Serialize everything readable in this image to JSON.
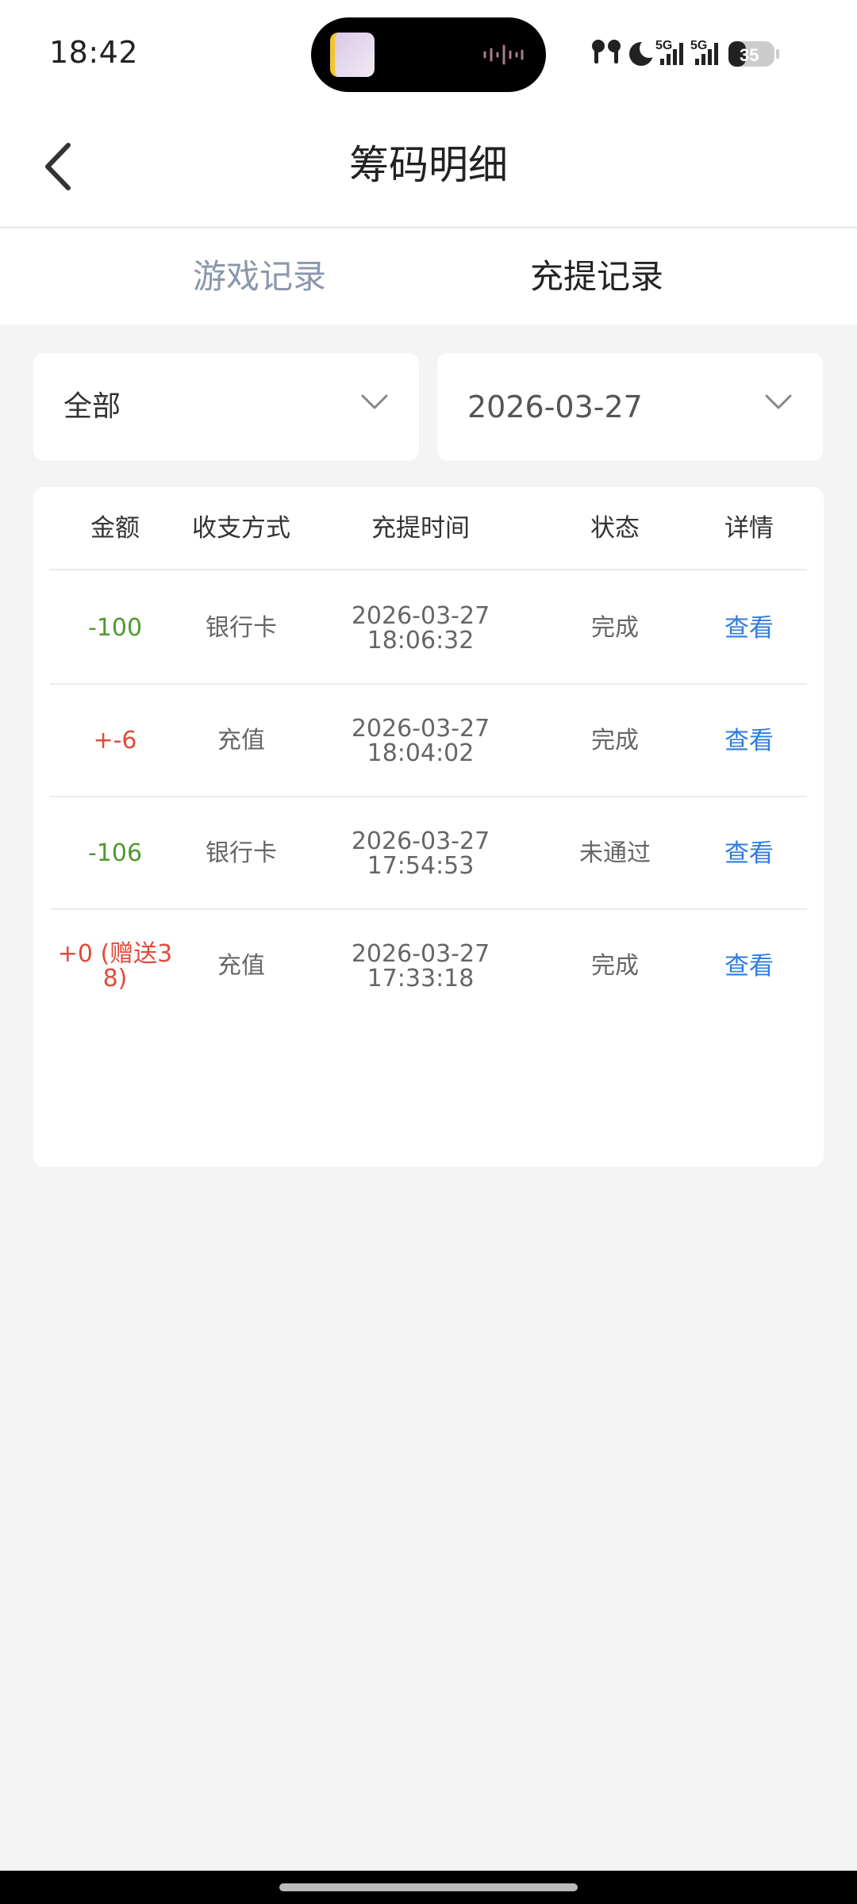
{
  "status_bar": {
    "time": "18:42",
    "signal_label_1": "5G",
    "signal_label_2": "5G",
    "battery": "35"
  },
  "header": {
    "title": "筹码明细"
  },
  "tabs": [
    {
      "label": "游戏记录",
      "active": false
    },
    {
      "label": "充提记录",
      "active": true
    }
  ],
  "filters": {
    "type": {
      "value": "全部"
    },
    "date": {
      "value": "2026-03-27"
    }
  },
  "table": {
    "columns": [
      "金额",
      "收支方式",
      "充提时间",
      "状态",
      "详情"
    ],
    "rows": [
      {
        "amount": "-100",
        "amount_sign": "negative",
        "method": "银行卡",
        "time": "2026-03-27\n18:06:32",
        "status": "完成",
        "detail": "查看"
      },
      {
        "amount": "+-6",
        "amount_sign": "positive",
        "method": "充值",
        "time": "2026-03-27\n18:04:02",
        "status": "完成",
        "detail": "查看"
      },
      {
        "amount": "-106",
        "amount_sign": "negative",
        "method": "银行卡",
        "time": "2026-03-27\n17:54:53",
        "status": "未通过",
        "detail": "查看"
      },
      {
        "amount": "+0 (赠送3\n8)",
        "amount_sign": "positive",
        "method": "充值",
        "time": "2026-03-27\n17:33:18",
        "status": "完成",
        "detail": "查看"
      }
    ]
  },
  "colors": {
    "negative_amount": "#4e9a2f",
    "positive_amount": "#e14b3b",
    "link": "#2f7de1",
    "inactive_tab": "#8a97ad"
  }
}
